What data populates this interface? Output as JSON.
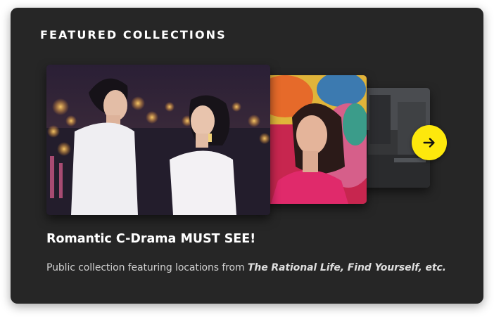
{
  "section": {
    "title": "FEATURED COLLECTIONS"
  },
  "carousel": {
    "slides": [
      {
        "icon": "drama-still-couple-night-city"
      },
      {
        "icon": "drama-still-woman-colorful"
      },
      {
        "icon": "drama-still-city-street"
      }
    ],
    "next_icon": "arrow-right-icon",
    "next_button_color": "#fde80c"
  },
  "collection": {
    "title": "Romantic C-Drama MUST SEE!",
    "description_prefix": "Public collection featuring locations from ",
    "description_titles": "The Rational Life, Find Yourself, etc."
  },
  "colors": {
    "card_background": "#262626",
    "accent": "#fde80c",
    "text_primary": "#ffffff",
    "text_secondary": "#d0d0d0"
  }
}
